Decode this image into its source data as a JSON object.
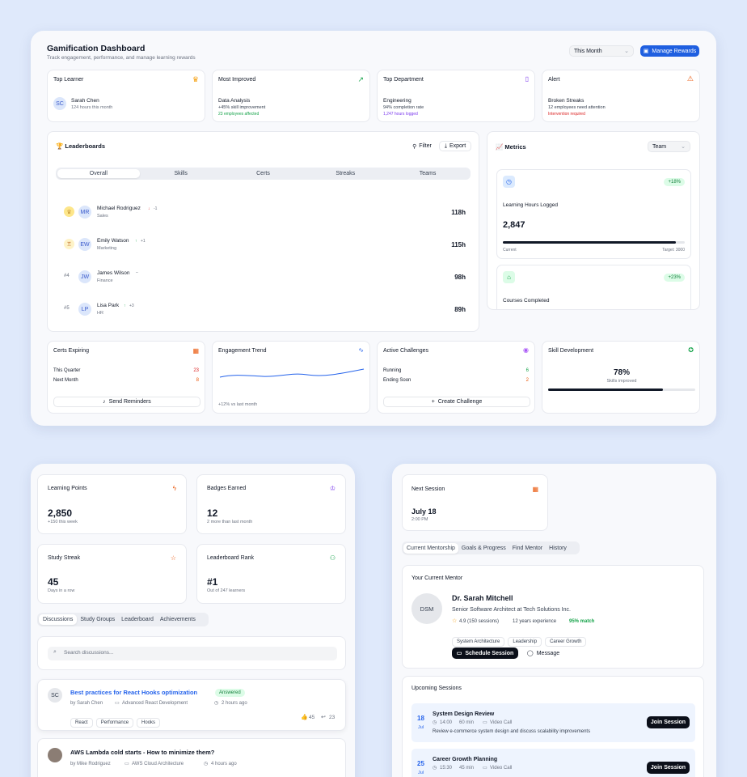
{
  "header": {
    "title": "Gamification Dashboard",
    "subtitle": "Track engagement, performance, and manage learning rewards",
    "period": "This Month",
    "manage_label": "Manage Rewards"
  },
  "stats": [
    {
      "title": "Top Learner",
      "avatar": "SC",
      "name": "Sarah Chen",
      "detail": "124 hours this month"
    },
    {
      "title": "Most Improved",
      "name": "Data Analysis",
      "detail": "+45% skill improvement",
      "extra": "23 employees affected"
    },
    {
      "title": "Top Department",
      "name": "Engineering",
      "detail": "94% completion rate",
      "extra": "1,247 hours logged"
    },
    {
      "title": "Alert",
      "name": "Broken Streaks",
      "detail": "12 employees need attention",
      "extra": "Intervention required"
    }
  ],
  "leaderboard": {
    "title": "🏆 Leaderboards",
    "filter_label": "Filter",
    "export_label": "Export",
    "tabs": [
      "Overall",
      "Skills",
      "Certs",
      "Streaks",
      "Teams"
    ],
    "rows": [
      {
        "rank": "",
        "avatar": "MR",
        "name": "Michael Rodriguez",
        "dept": "Sales",
        "delta": "-1",
        "hours": "118h"
      },
      {
        "rank": "",
        "avatar": "EW",
        "name": "Emily Watson",
        "dept": "Marketing",
        "delta": "+1",
        "hours": "115h"
      },
      {
        "rank": "#4",
        "avatar": "JW",
        "name": "James Wilson",
        "dept": "Finance",
        "delta": "",
        "hours": "98h"
      },
      {
        "rank": "#5",
        "avatar": "LP",
        "name": "Lisa Park",
        "dept": "HR",
        "delta": "+3",
        "hours": "89h"
      }
    ]
  },
  "metrics": {
    "title": "📈 Metrics",
    "select": "Team",
    "card1": {
      "badge": "+18%",
      "label": "Learning Hours Logged",
      "value": "2,847",
      "current": "Current",
      "target": "Target: 3000",
      "progress": 0.95
    },
    "card2": {
      "badge": "+23%",
      "label": "Courses Completed"
    }
  },
  "bottom": {
    "certs": {
      "title": "Certs Expiring",
      "row1": "This Quarter",
      "val1": "23",
      "row2": "Next Month",
      "val2": "8",
      "button": "Send Reminders"
    },
    "trend": {
      "title": "Engagement Trend",
      "caption": "+12% vs last month"
    },
    "challenges": {
      "title": "Active Challenges",
      "row1": "Running",
      "val1": "6",
      "row2": "Ending Soon",
      "val2": "2",
      "button": "Create Challenge"
    },
    "skills": {
      "title": "Skill Development",
      "value": "78%",
      "caption": "Skills improved",
      "progress": 0.78
    }
  },
  "learner": {
    "cards": [
      {
        "title": "Learning Points",
        "value": "2,850",
        "caption": "+150 this week"
      },
      {
        "title": "Badges Earned",
        "value": "12",
        "caption": "2 more than last month"
      },
      {
        "title": "Study Streak",
        "value": "45",
        "caption": "Days in a row"
      },
      {
        "title": "Leaderboard Rank",
        "value": "#1",
        "caption": "Out of 247 learners"
      }
    ],
    "tabs": [
      "Discussions",
      "Study Groups",
      "Leaderboard",
      "Achievements"
    ],
    "search_placeholder": "Search discussions...",
    "posts": [
      {
        "avatar": "SC",
        "title": "Best practices for React Hooks optimization",
        "status": "Answered",
        "author": "by Sarah Chen",
        "course": "Advanced React Development",
        "time": "2 hours ago",
        "tags": [
          "React",
          "Performance",
          "Hooks"
        ],
        "likes": "45",
        "replies": "23"
      },
      {
        "title": "AWS Lambda cold starts - How to minimize them?",
        "author": "by Mike Rodriguez",
        "course": "AWS Cloud Architecture",
        "time": "4 hours ago"
      }
    ]
  },
  "mentor": {
    "next": {
      "title": "Next Session",
      "date": "July 18",
      "time": "2:00 PM"
    },
    "tabs": [
      "Current Mentorship",
      "Goals & Progress",
      "Find Mentor",
      "History"
    ],
    "current_title": "Your Current Mentor",
    "avatar": "DSM",
    "name": "Dr. Sarah Mitchell",
    "role": "Senior Software Architect at Tech Solutions Inc.",
    "rating": "4.9 (150 sessions)",
    "experience": "12 years experience",
    "match": "95% match",
    "tags": [
      "System Architecture",
      "Leadership",
      "Career Growth"
    ],
    "schedule_label": "Schedule Session",
    "message_label": "Message",
    "upcoming_title": "Upcoming Sessions",
    "sessions": [
      {
        "day": "18",
        "month": "Jul",
        "title": "System Design Review",
        "time": "14:00",
        "duration": "60 min",
        "mode": "Video Call",
        "desc": "Review e-commerce system design and discuss scalability improvements",
        "join": "Join Session"
      },
      {
        "day": "25",
        "month": "Jul",
        "title": "Career Growth Planning",
        "time": "15:30",
        "duration": "45 min",
        "mode": "Video Call",
        "join": "Join Session"
      }
    ]
  }
}
